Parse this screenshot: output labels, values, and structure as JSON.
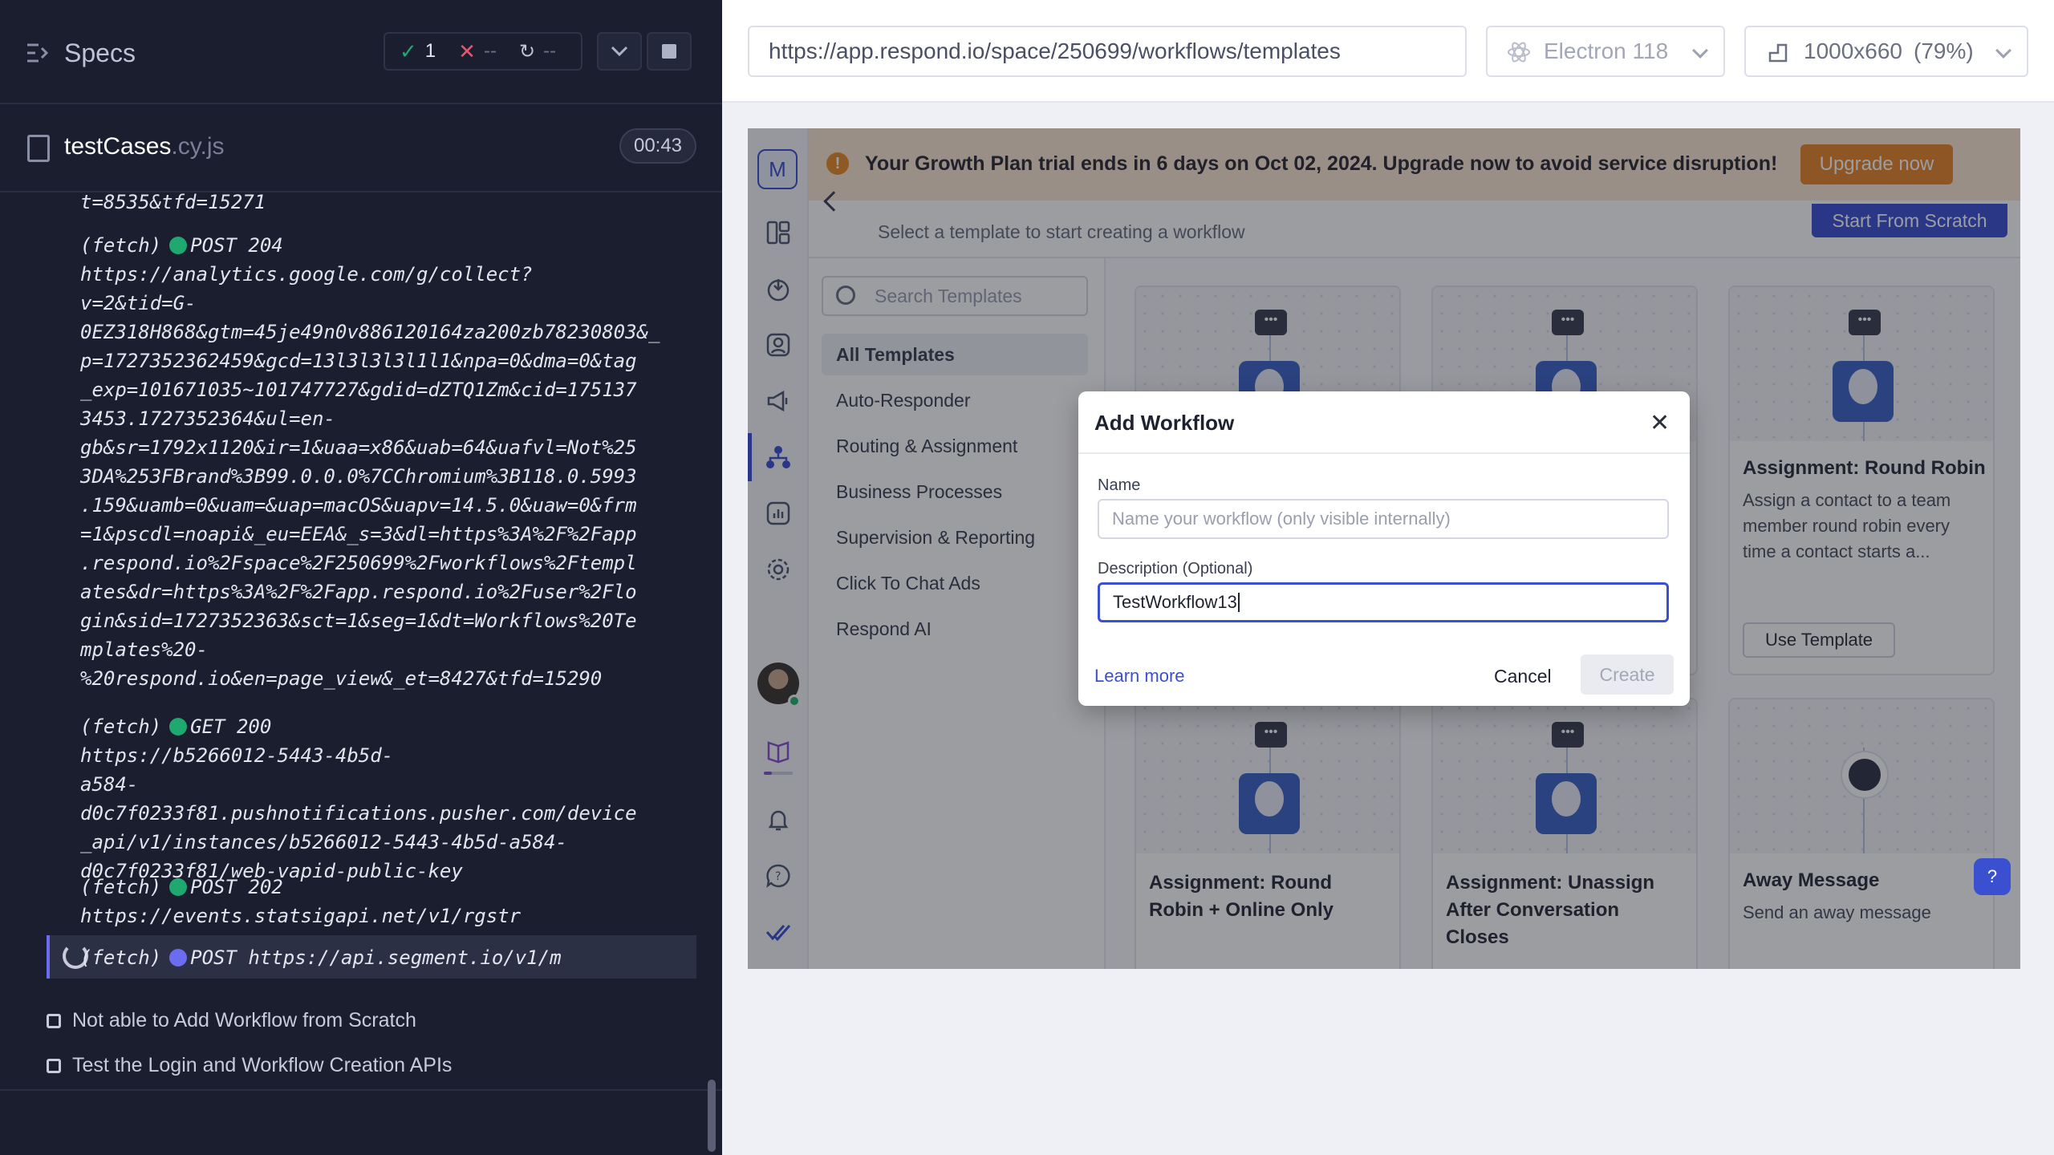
{
  "runner": {
    "title": "Specs",
    "stats": {
      "passed": "1",
      "failed": "--",
      "pending": "--"
    },
    "spec_file": {
      "name": "testCases",
      "ext": ".cy.js"
    },
    "timer": "00:43",
    "log": [
      "t=8535&tfd=15271",
      "(fetch)",
      "POST 204",
      "https://analytics.google.com/g/collect?\nv=2&tid=G-\n0EZ318H868&gtm=45je49n0v886120164za200zb78230803&_\np=1727352362459&gcd=13l3l3l3l1l1&npa=0&dma=0&tag\n_exp=101671035~101747727&gdid=dZTQ1Zm&cid=175137\n3453.1727352364&ul=en-\ngb&sr=1792x1120&ir=1&uaa=x86&uab=64&uafvl=Not%25\n3DA%253FBrand%3B99.0.0.0%7CChromium%3B118.0.5993\n.159&uamb=0&uam=&uap=macOS&uapv=14.5.0&uaw=0&frm\n=1&pscdl=noapi&_eu=EEA&_s=3&dl=https%3A%2F%2Fapp\n.respond.io%2Fspace%2F250699%2Fworkflows%2Ftempl\nates&dr=https%3A%2F%2Fapp.respond.io%2Fuser%2Flo\ngin&sid=1727352363&sct=1&seg=1&dt=Workflows%20Te\nmplates%20-\n%20respond.io&en=page_view&_et=8427&tfd=15290",
      "GET 200",
      "https://b5266012-5443-4b5d-\na584-\nd0c7f0233f81.pushnotifications.pusher.com/device\n_api/v1/instances/b5266012-5443-4b5d-a584-\nd0c7f0233f81/web-vapid-public-key",
      "POST 202",
      "https://events.statsigapi.net/v1/rgstr",
      "POST https://api.segment.io/v1/m"
    ],
    "tests": [
      "Not able to Add Workflow from Scratch",
      "Test the Login and Workflow Creation APIs"
    ]
  },
  "browser_bar": {
    "url": "https://app.respond.io/space/250699/workflows/templates",
    "browser": "Electron 118",
    "viewport": "1000x660",
    "zoom": "(79%)"
  },
  "app": {
    "workspace_initial": "M",
    "banner": {
      "text": "Your Growth Plan trial ends in 6 days on Oct 02, 2024. Upgrade now to avoid service disruption!",
      "button": "Upgrade now"
    },
    "subtitle": "Select a template to start creating a workflow",
    "start_button": "Start From Scratch",
    "search_placeholder": "Search Templates",
    "categories": [
      "All Templates",
      "Auto-Responder",
      "Routing & Assignment",
      "Business Processes",
      "Supervision & Reporting",
      "Click To Chat Ads",
      "Respond AI"
    ],
    "cards": [
      {
        "title": "Assignment: Round Robin",
        "desc": "Assign a contact to a team member round robin every time a contact starts a...",
        "button": "Use Template"
      },
      {
        "title": "Assignment: Round Robin + Online Only"
      },
      {
        "title": "Assignment: Unassign After Conversation Closes"
      },
      {
        "title": "Away Message",
        "desc": "Send an away message"
      }
    ]
  },
  "modal": {
    "title": "Add Workflow",
    "name_label": "Name",
    "name_placeholder": "Name your workflow (only visible internally)",
    "desc_label": "Description (Optional)",
    "desc_value": "TestWorkflow13",
    "learn_more": "Learn more",
    "cancel": "Cancel",
    "create": "Create"
  },
  "colors": {
    "accent": "#3b4fd1",
    "pass": "#1fa971",
    "fail": "#e45770",
    "warning": "#e8862a"
  }
}
